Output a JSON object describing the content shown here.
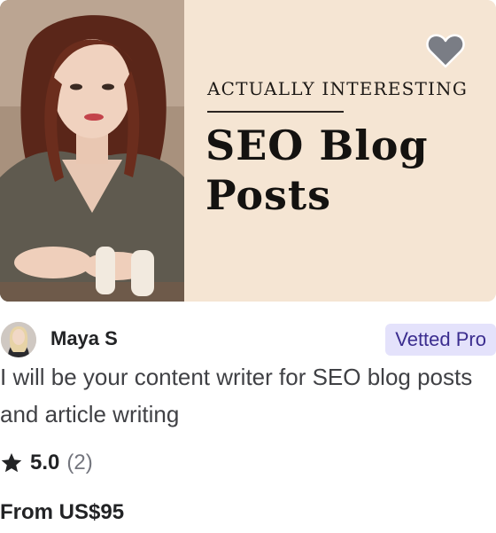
{
  "thumbnail": {
    "eyebrow": "ACTUALLY INTERESTING",
    "headline_line1": "SEO Blog",
    "headline_line2": "Posts",
    "background_color": "#f5e5d3",
    "favorite_icon": "heart-icon"
  },
  "seller": {
    "name": "Maya S",
    "badge": "Vetted Pro",
    "badge_color": "#e4e2fb",
    "badge_text_color": "#3b2d8f"
  },
  "gig": {
    "title": "I will be your content writer for SEO blog posts and article writing"
  },
  "rating": {
    "icon": "star-icon",
    "value": "5.0",
    "count": "(2)"
  },
  "price": {
    "label": "From US$95"
  }
}
